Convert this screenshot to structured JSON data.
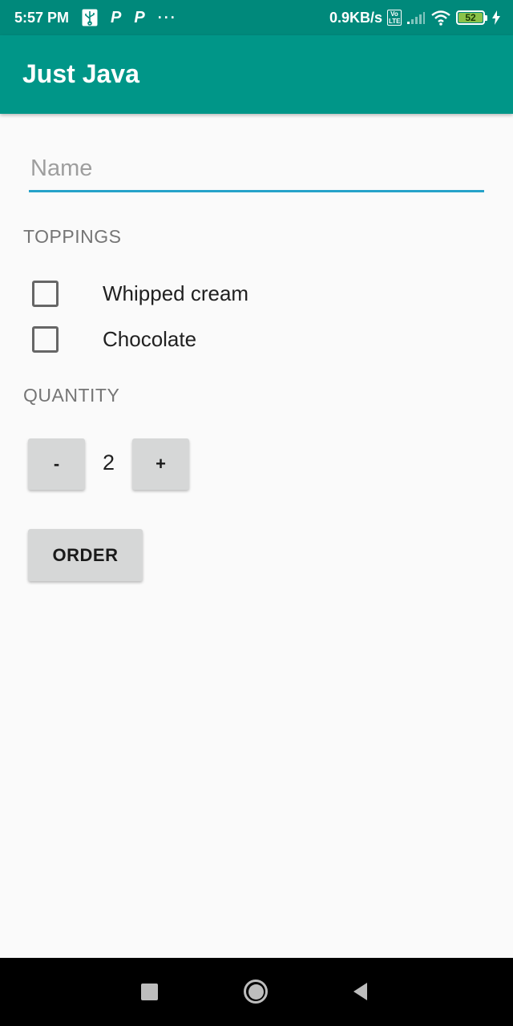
{
  "status_bar": {
    "time": "5:57 PM",
    "network_speed": "0.9KB/s",
    "volte_label": "Vo\nLTE",
    "battery_level": "52",
    "icons": [
      "usb-icon",
      "p-app-icon",
      "p-app-icon",
      "more-dots-icon",
      "volte-icon",
      "signal-icon",
      "wifi-icon",
      "battery-icon",
      "charging-icon"
    ],
    "p_glyph": "P",
    "dots": "···"
  },
  "app_bar": {
    "title": "Just Java"
  },
  "form": {
    "name_placeholder": "Name",
    "name_value": ""
  },
  "toppings": {
    "label": "TOPPINGS",
    "items": [
      {
        "label": "Whipped cream",
        "checked": false
      },
      {
        "label": "Chocolate",
        "checked": false
      }
    ]
  },
  "quantity": {
    "label": "QUANTITY",
    "minus_label": "-",
    "value": "2",
    "plus_label": "+"
  },
  "order": {
    "button_label": "ORDER"
  },
  "colors": {
    "status_bar": "#00897b",
    "app_bar": "#009688",
    "accent": "#26a2c9",
    "background": "#fafafa",
    "button": "#d6d7d7"
  },
  "nav_bar": {
    "icons": [
      "recents-icon",
      "home-icon",
      "back-icon"
    ]
  }
}
